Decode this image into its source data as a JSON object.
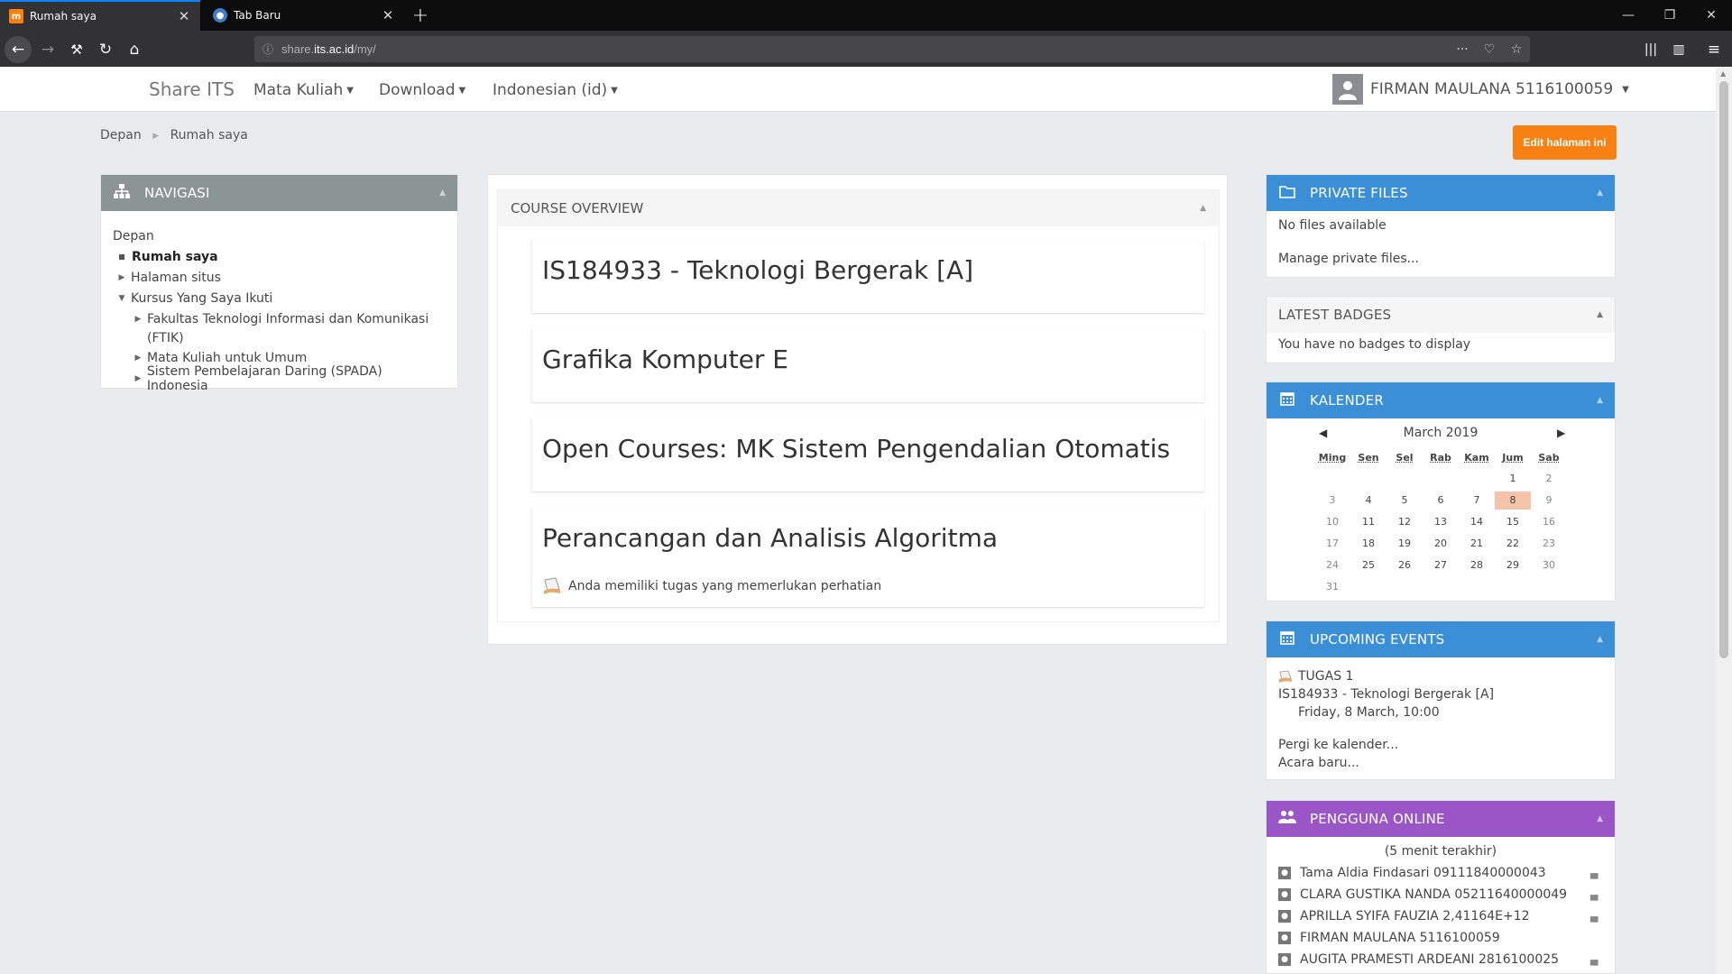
{
  "browser": {
    "tabs": [
      {
        "title": "Rumah saya",
        "active": true
      },
      {
        "title": "Tab Baru",
        "active": false
      }
    ],
    "url_prefix": "share.",
    "url_domain": "its.ac.id",
    "url_path": "/my/"
  },
  "header": {
    "brand": "Share ITS",
    "menus": [
      "Mata Kuliah",
      "Download",
      "Indonesian (id)"
    ],
    "user": "FIRMAN MAULANA 5116100059"
  },
  "breadcrumb": [
    "Depan",
    "Rumah saya"
  ],
  "edit_button": "Edit halaman ini",
  "navigasi": {
    "title": "NAVIGASI",
    "items": [
      {
        "label": "Depan"
      },
      {
        "label": "Rumah saya"
      },
      {
        "label": "Halaman situs"
      },
      {
        "label": "Kursus Yang Saya Ikuti"
      },
      {
        "label": "Fakultas Teknologi Informasi dan Komunikasi"
      },
      {
        "label": "(FTIK)"
      },
      {
        "label": "Mata Kuliah untuk Umum"
      },
      {
        "label": "Sistem Pembelajaran Daring (SPADA) Indonesia"
      }
    ]
  },
  "course_overview": {
    "title": "COURSE OVERVIEW",
    "courses": [
      {
        "name": "IS184933 - Teknologi Bergerak [A]"
      },
      {
        "name": "Grafika Komputer E"
      },
      {
        "name": "Open Courses: MK Sistem Pengendalian Otomatis"
      },
      {
        "name": "Perancangan dan Analisis Algoritma",
        "notice": "Anda memiliki tugas yang memerlukan perhatian"
      }
    ]
  },
  "private_files": {
    "title": "PRIVATE FILES",
    "status": "No files available",
    "link": "Manage private files..."
  },
  "latest_badges": {
    "title": "LATEST BADGES",
    "status": "You have no badges to display"
  },
  "kalender": {
    "title": "KALENDER",
    "month": "March 2019",
    "prev": "◀",
    "next": "▶",
    "days": [
      "Ming",
      "Sen",
      "Sel",
      "Rab",
      "Kam",
      "Jum",
      "Sab"
    ],
    "weeks": [
      [
        "",
        "",
        "",
        "",
        "",
        "1",
        "2"
      ],
      [
        "3",
        "4",
        "5",
        "6",
        "7",
        "8",
        "9"
      ],
      [
        "10",
        "11",
        "12",
        "13",
        "14",
        "15",
        "16"
      ],
      [
        "17",
        "18",
        "19",
        "20",
        "21",
        "22",
        "23"
      ],
      [
        "24",
        "25",
        "26",
        "27",
        "28",
        "29",
        "30"
      ],
      [
        "31",
        "",
        "",
        "",
        "",
        "",
        ""
      ]
    ],
    "today": "8"
  },
  "upcoming_events": {
    "title": "UPCOMING EVENTS",
    "event_name": "TUGAS 1",
    "event_course": "IS184933 - Teknologi Bergerak [A]",
    "event_time": "Friday, 8 March, 10:00",
    "goto_calendar": "Pergi ke kalender...",
    "new_event": "Acara baru..."
  },
  "pengguna_online": {
    "title": "PENGGUNA ONLINE",
    "subtitle": "(5 menit terakhir)",
    "users": [
      {
        "name": "Tama Aldia Findasari 09111840000043"
      },
      {
        "name": "CLARA GUSTIKA NANDA 05211640000049"
      },
      {
        "name": "APRILLA SYIFA FAUZIA 2,41164E+12"
      },
      {
        "name": "FIRMAN MAULANA 5116100059"
      },
      {
        "name": "AUGITA PRAMESTI ARDEANI 2816100025"
      }
    ]
  },
  "colors": {
    "accent_orange": "#f98012",
    "block_blue": "#3a8fd6",
    "block_purple": "#9a56c6",
    "nav_gray": "#8c9595"
  }
}
